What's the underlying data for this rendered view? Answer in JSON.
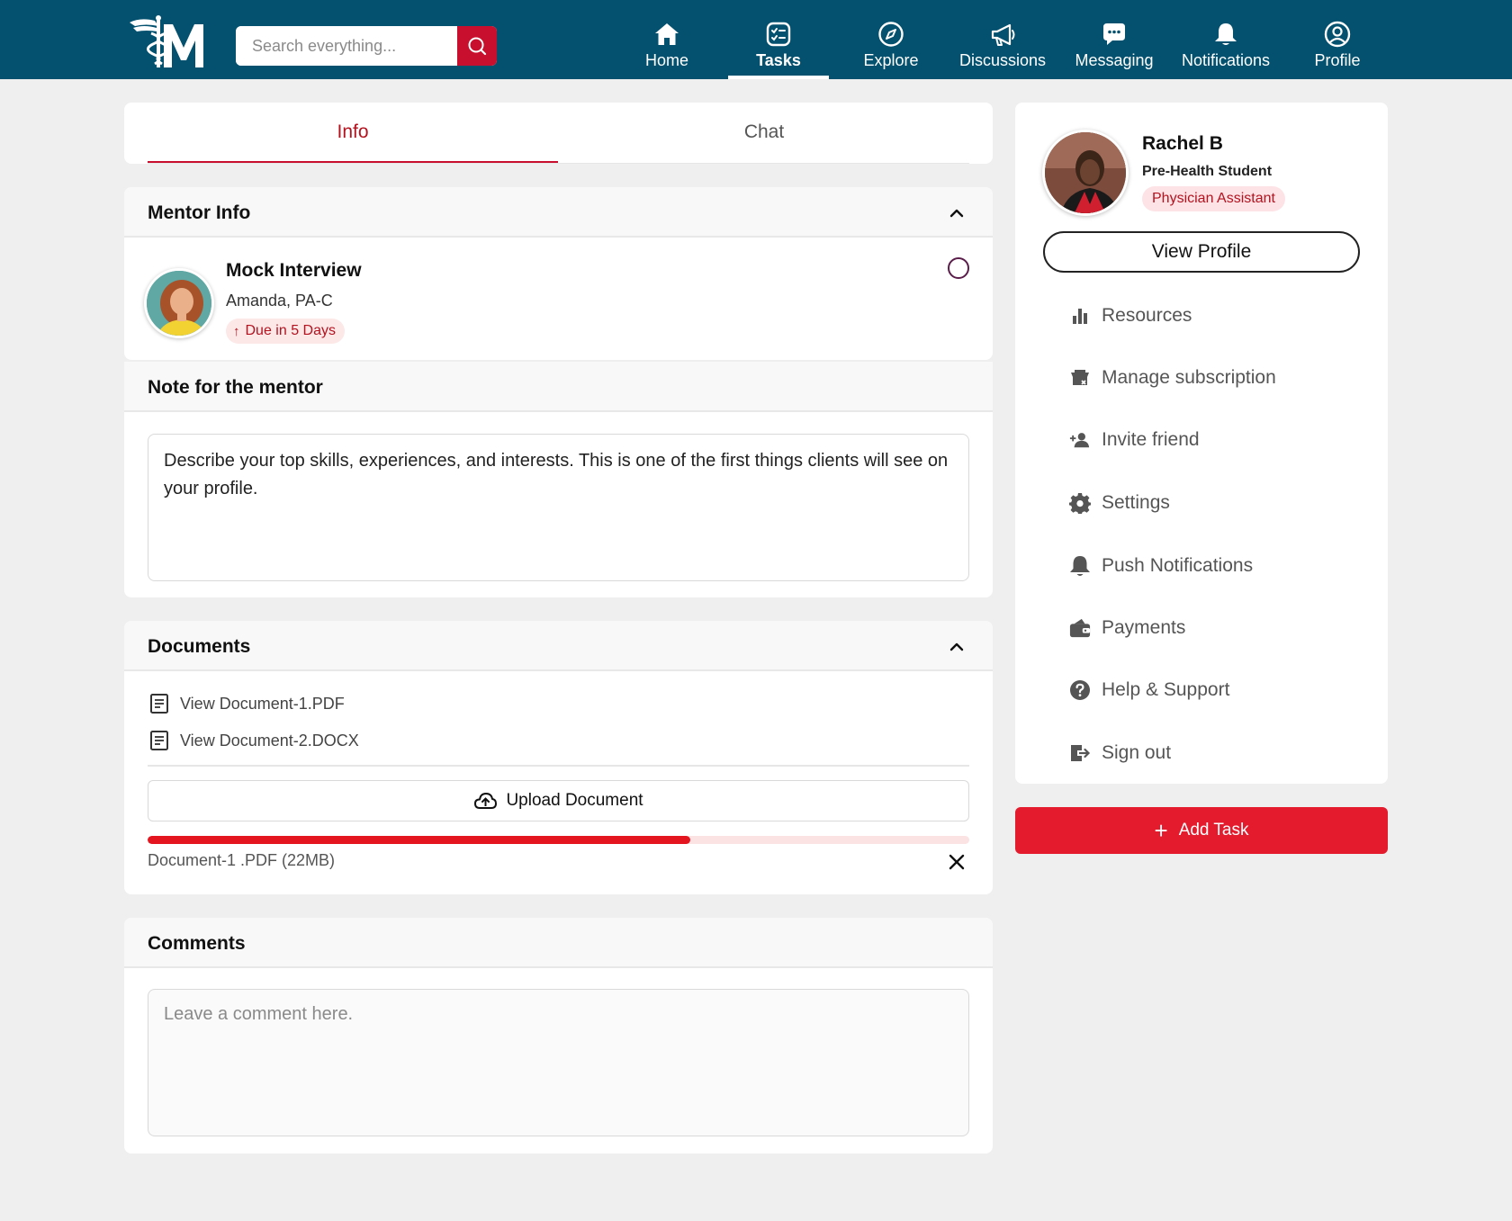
{
  "header": {
    "search_placeholder": "Search everything...",
    "nav": [
      {
        "label": "Home",
        "icon": "home-icon"
      },
      {
        "label": "Tasks",
        "icon": "tasks-icon",
        "active": true
      },
      {
        "label": "Explore",
        "icon": "compass-icon"
      },
      {
        "label": "Discussions",
        "icon": "megaphone-icon"
      },
      {
        "label": "Messaging",
        "icon": "chat-bubble-icon"
      },
      {
        "label": "Notifications",
        "icon": "bell-icon"
      },
      {
        "label": "Profile",
        "icon": "user-circle-icon"
      }
    ]
  },
  "tabs": {
    "info": "Info",
    "chat": "Chat",
    "active": "Info"
  },
  "mentor_info": {
    "section_title": "Mentor Info",
    "task_title": "Mock Interview",
    "mentor_name": "Amanda, PA-C",
    "due": "Due in 5 Days"
  },
  "note": {
    "section_title": "Note for the mentor",
    "text": "Describe your top skills, experiences, and interests. This is one of the first things clients will see on your profile."
  },
  "documents": {
    "section_title": "Documents",
    "files": [
      "View Document-1.PDF",
      "View Document-2.DOCX"
    ],
    "upload_label": "Upload Document",
    "upload_progress": 0.66,
    "uploading_file": "Document-1 .PDF (22MB)"
  },
  "comments": {
    "section_title": "Comments",
    "placeholder": "Leave a comment here."
  },
  "profile": {
    "name": "Rachel B",
    "role": "Pre-Health Student",
    "badge": "Physician Assistant",
    "view_profile_label": "View Profile"
  },
  "menu": [
    {
      "label": "Resources",
      "icon": "bar-chart-icon"
    },
    {
      "label": "Manage subscription",
      "icon": "subscription-icon"
    },
    {
      "label": "Invite friend",
      "icon": "add-person-icon"
    },
    {
      "label": "Settings",
      "icon": "gear-icon"
    },
    {
      "label": "Push Notifications",
      "icon": "bell-icon"
    },
    {
      "label": "Payments",
      "icon": "wallet-icon"
    },
    {
      "label": "Help & Support",
      "icon": "help-icon"
    },
    {
      "label": "Sign out",
      "icon": "sign-out-icon"
    }
  ],
  "add_task_label": "Add Task",
  "colors": {
    "header_bg": "#03516e",
    "accent_red": "#e41b2d",
    "tab_active": "#b3121f"
  }
}
